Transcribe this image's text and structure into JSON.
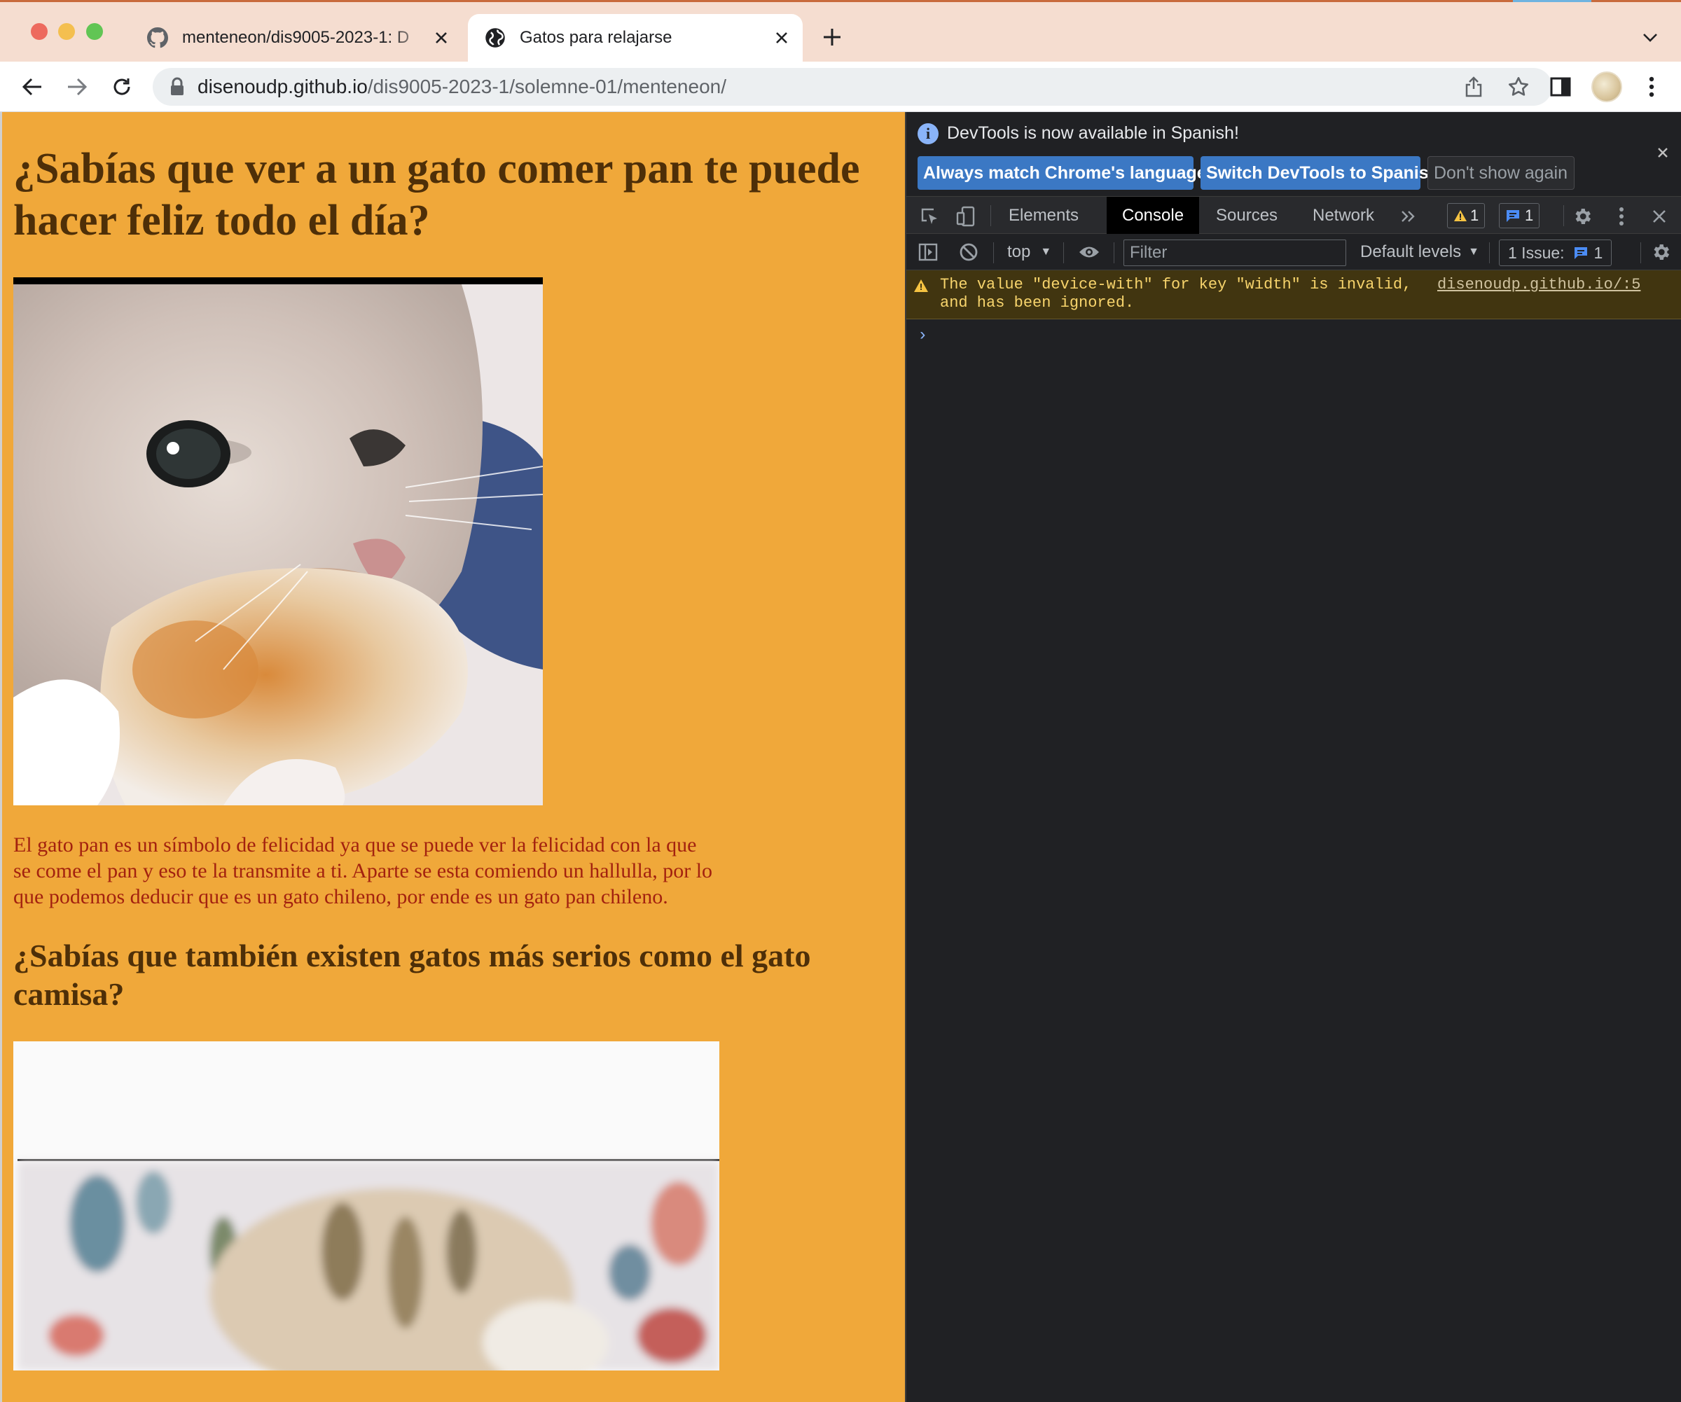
{
  "browser": {
    "tabs": [
      {
        "title": "menteneon/dis9005-2023-1: D",
        "favicon": "github-icon",
        "active": false
      },
      {
        "title": "Gatos para relajarse",
        "favicon": "globe-icon",
        "active": true
      }
    ],
    "url_host": "disenoudp.github.io",
    "url_path": "/dis9005-2023-1/solemne-01/menteneon/"
  },
  "page": {
    "heading1": "¿Sabías que ver a un gato comer pan te puede hacer feliz todo el día?",
    "paragraph": "El gato pan es un símbolo de felicidad ya que se puede ver la felicidad con la que se come el pan y eso te la transmite a ti. Aparte se esta comiendo un hallulla, por lo que podemos deducir que es un gato chileno, por ende es un gato pan chileno.",
    "heading2": "¿Sabías que también existen gatos más serios como el gato camisa?",
    "background_color": "#f0a83a",
    "heading_color": "#4e2f08",
    "paragraph_color": "#a3220f"
  },
  "devtools": {
    "infobar": {
      "message": "DevTools is now available in Spanish!",
      "btn_match": "Always match Chrome's language",
      "btn_switch": "Switch DevTools to Spanish",
      "btn_dismiss": "Don't show again"
    },
    "tabs": [
      "Elements",
      "Console",
      "Sources",
      "Network"
    ],
    "active_tab": "Console",
    "warning_count": "1",
    "message_count": "1",
    "console": {
      "context": "top",
      "filter_placeholder": "Filter",
      "levels": "Default levels",
      "issues_label": "1 Issue:",
      "issues_count": "1"
    },
    "warning": {
      "text": "The value \"device-with\" for key \"width\" is invalid,\nand has been ignored.",
      "source": "disenoudp.github.io/:5"
    },
    "prompt": "›"
  }
}
